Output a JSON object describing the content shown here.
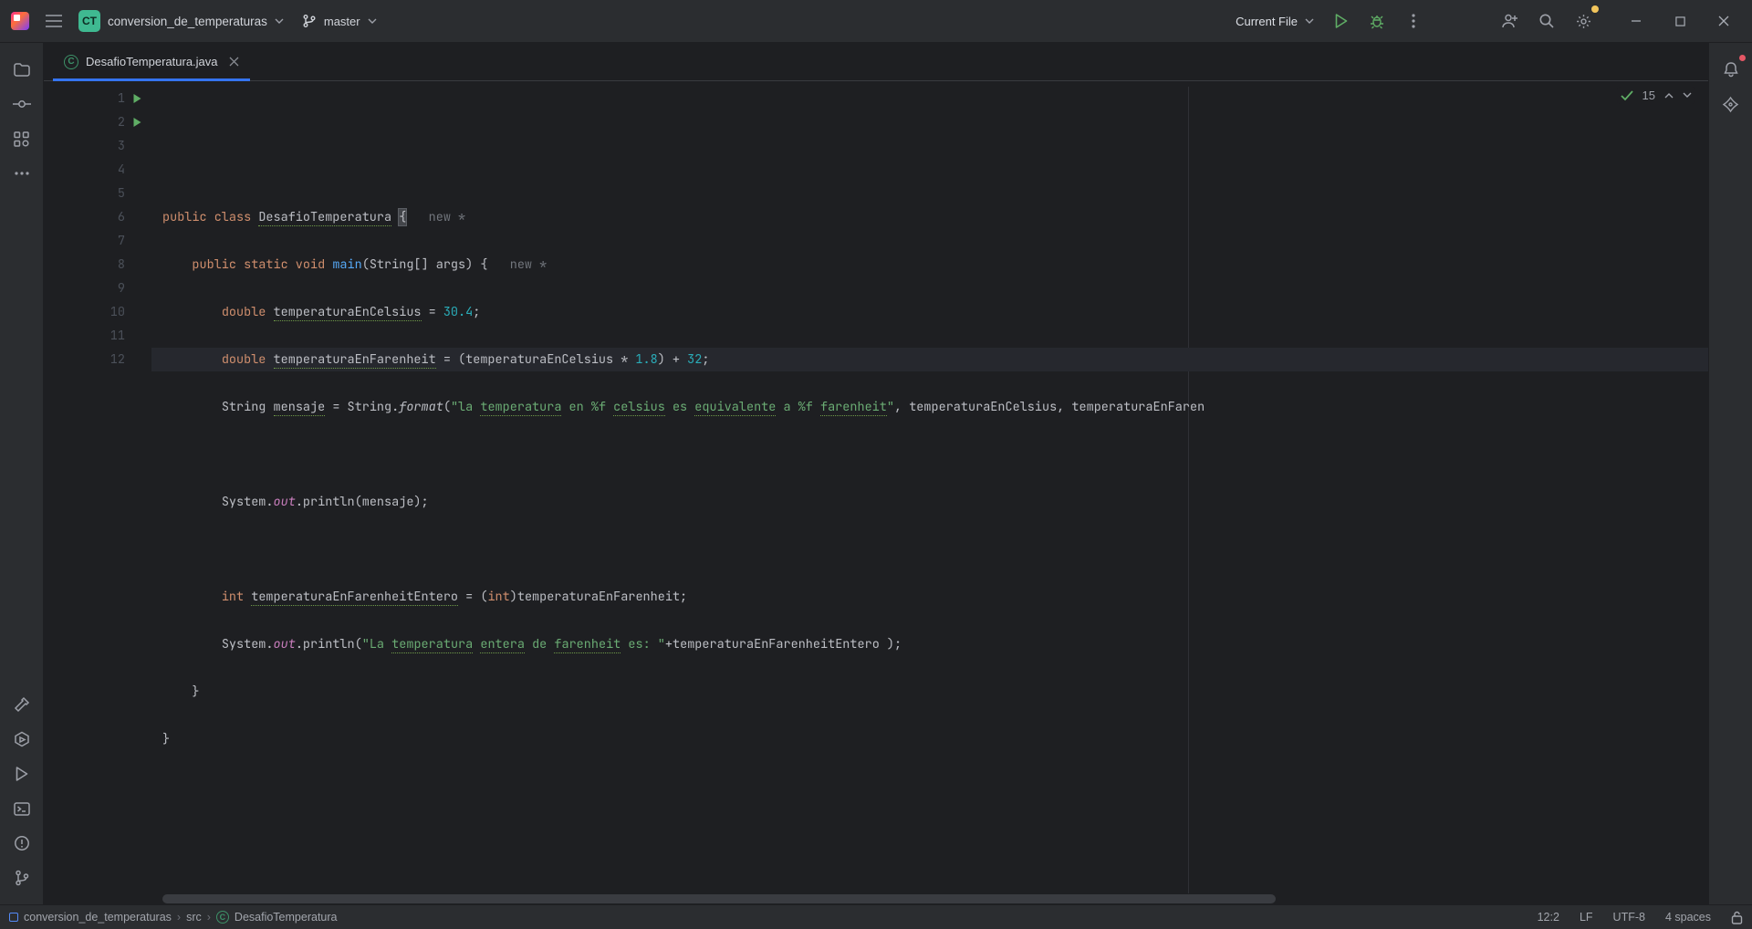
{
  "titlebar": {
    "project_badge": "CT",
    "project_name": "conversion_de_temperaturas",
    "branch": "master",
    "run_config": "Current File"
  },
  "tab": {
    "filename": "DesafioTemperatura.java"
  },
  "inspection": {
    "count": "15"
  },
  "gutter": {
    "lines": [
      "1",
      "2",
      "3",
      "4",
      "5",
      "6",
      "7",
      "8",
      "9",
      "10",
      "11",
      "12"
    ]
  },
  "code": {
    "l1": {
      "a": "public class ",
      "b": "DesafioTemperatura",
      "c": " {",
      "hint": "new *"
    },
    "l2": {
      "a": "public static void ",
      "b": "main",
      "c": "(String[] args) {",
      "hint": "new *"
    },
    "l3": {
      "a": "double ",
      "b": "temperaturaEnCelsius",
      "c": " = ",
      "d": "30.4",
      "e": ";"
    },
    "l4": {
      "a": "double ",
      "b": "temperaturaEnFarenheit",
      "c": " = (temperaturaEnCelsius * ",
      "d": "1.8",
      "e": ") + ",
      "f": "32",
      "g": ";"
    },
    "l5": {
      "a": "String ",
      "b": "mensaje",
      "c": " = String.",
      "d": "format",
      "e": "(",
      "s1": "\"la ",
      "s2": "temperatura",
      "s3": " en %f ",
      "s4": "celsius",
      "s5": " es ",
      "s6": "equivalente",
      "s7": " a %f ",
      "s8": "farenheit",
      "s9": "\"",
      "f": ", temperaturaEnCelsius, temperaturaEnFaren"
    },
    "l7": {
      "a": "System.",
      "b": "out",
      "c": ".println(mensaje);"
    },
    "l9": {
      "a": "int ",
      "b": "temperaturaEnFarenheitEntero",
      "c": " = (",
      "d": "int",
      "e": ")temperaturaEnFarenheit;"
    },
    "l10": {
      "a": "System.",
      "b": "out",
      "c": ".println(",
      "s1": "\"La ",
      "s2": "temperatura",
      "s3": " ",
      "s4": "entera",
      "s5": " de ",
      "s6": "farenheit",
      "s7": " es: \"",
      "d": "+temperaturaEnFarenheitEntero );"
    },
    "l11": "    }",
    "l12": "}"
  },
  "breadcrumbs": {
    "a": "conversion_de_temperaturas",
    "b": "src",
    "c": "DesafioTemperatura"
  },
  "status": {
    "pos": "12:2",
    "le": "LF",
    "enc": "UTF-8",
    "indent": "4 spaces"
  }
}
